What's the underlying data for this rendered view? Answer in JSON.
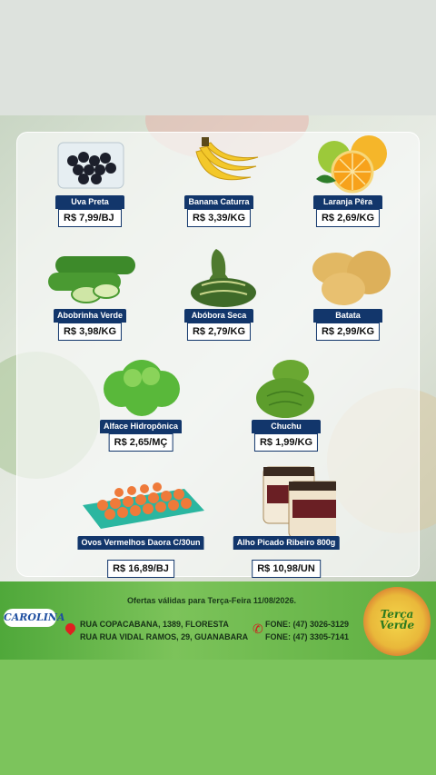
{
  "products": [
    {
      "name": "Uva Preta",
      "price": "R$ 7,99/BJ"
    },
    {
      "name": "Banana Caturra",
      "price": "R$ 3,39/KG"
    },
    {
      "name": "Laranja Pêra",
      "price": "R$ 2,69/KG"
    },
    {
      "name": "Abobrinha Verde",
      "price": "R$ 3,98/KG"
    },
    {
      "name": "Abóbora Seca",
      "price": "R$ 2,79/KG"
    },
    {
      "name": "Batata",
      "price": "R$ 2,99/KG"
    },
    {
      "name": "Alface Hidropônica",
      "price": "R$ 2,65/MÇ"
    },
    {
      "name": "Chuchu",
      "price": "R$ 1,99/KG"
    },
    {
      "name": "Ovos Vermelhos Daora C/30un",
      "price": "R$ 16,89/BJ"
    },
    {
      "name": "Alho Picado Ribeiro 800g",
      "price": "R$ 10,98/UN"
    }
  ],
  "footer": {
    "offer_text": "Ofertas válidas para Terça-Feira 11/08/2026.",
    "logo": "CAROLINA",
    "address1": "RUA COPACABANA, 1389, FLORESTA",
    "address2": "RUA RUA VIDAL RAMOS, 29, GUANABARA",
    "phone1": "FONE: (47) 3026-3129",
    "phone2": "FONE: (47) 3305-7141",
    "badge_line1": "Terça",
    "badge_line2": "Verde"
  },
  "colors": {
    "label_bg": "#12366b",
    "footer_green": "#5cae40",
    "bottom_green": "#7cc45c"
  }
}
